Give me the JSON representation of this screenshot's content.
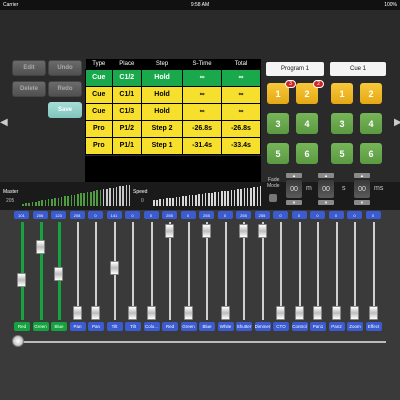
{
  "status": {
    "carrier": "Carrier",
    "time": "9:58 AM",
    "battery": "100%"
  },
  "editor": {
    "edit": "Edit",
    "undo": "Undo",
    "delete": "Delete",
    "redo": "Redo",
    "save": "Save"
  },
  "cues": {
    "headers": [
      "Type",
      "Place",
      "Step",
      "S-Time",
      "Total"
    ],
    "rows": [
      {
        "type": "Cue",
        "place": "C1/2",
        "step": "Hold",
        "stime": "∞",
        "total": "∞",
        "color": "green"
      },
      {
        "type": "Cue",
        "place": "C1/1",
        "step": "Hold",
        "stime": "∞",
        "total": "∞",
        "color": "yellow"
      },
      {
        "type": "Cue",
        "place": "C1/3",
        "step": "Hold",
        "stime": "∞",
        "total": "∞",
        "color": "yellow"
      },
      {
        "type": "Pro",
        "place": "P1/2",
        "step": "Step 2",
        "stime": "-26.8s",
        "total": "-26.8s",
        "color": "yellow"
      },
      {
        "type": "Pro",
        "place": "P1/1",
        "step": "Step 1",
        "stime": "-31.4s",
        "total": "-33.4s",
        "color": "yellow"
      }
    ]
  },
  "tabs": {
    "program": "Program 1",
    "cue": "Cue 1"
  },
  "pads": {
    "left": [
      "1",
      "2",
      "3",
      "4",
      "5",
      "6"
    ],
    "right": [
      "1",
      "2",
      "3",
      "4",
      "5",
      "6"
    ],
    "badges": [
      "3",
      "2"
    ]
  },
  "fade": {
    "label1": "Fade",
    "label2": "Mode",
    "m_value": "00",
    "m_unit": "m",
    "s_value": "00",
    "s_unit": "s",
    "ms_value": "00",
    "ms_unit": "ms"
  },
  "master": {
    "label": "Master",
    "value": "205"
  },
  "speed": {
    "label": "Speed",
    "value": "0"
  },
  "channels": [
    {
      "name": "Red",
      "value": "101",
      "level": 0.4,
      "color": "green"
    },
    {
      "name": "Green",
      "value": "206",
      "level": 0.81,
      "color": "green"
    },
    {
      "name": "Blue",
      "value": "123",
      "level": 0.48,
      "color": "green"
    },
    {
      "name": "Pan",
      "value": "208",
      "level": 0.0,
      "color": "blue"
    },
    {
      "name": "Pan",
      "value": "0",
      "level": 0.0,
      "color": "blue"
    },
    {
      "name": "Tilt",
      "value": "141",
      "level": 0.55,
      "color": "blue"
    },
    {
      "name": "Tilt",
      "value": "0",
      "level": 0.0,
      "color": "blue"
    },
    {
      "name": "Colo...",
      "value": "0",
      "level": 0.0,
      "color": "blue"
    },
    {
      "name": "Red",
      "value": "255",
      "level": 1.0,
      "color": "blue"
    },
    {
      "name": "Green",
      "value": "0",
      "level": 0.0,
      "color": "blue"
    },
    {
      "name": "Blue",
      "value": "255",
      "level": 1.0,
      "color": "blue"
    },
    {
      "name": "White",
      "value": "0",
      "level": 0.0,
      "color": "blue"
    },
    {
      "name": "Shutter",
      "value": "255",
      "level": 1.0,
      "color": "blue"
    },
    {
      "name": "Dimmer",
      "value": "255",
      "level": 1.0,
      "color": "blue"
    },
    {
      "name": "CTO",
      "value": "0",
      "level": 0.0,
      "color": "blue"
    },
    {
      "name": "Control",
      "value": "0",
      "level": 0.0,
      "color": "blue"
    },
    {
      "name": "Pan1",
      "value": "0",
      "level": 0.0,
      "color": "blue"
    },
    {
      "name": "Pan2",
      "value": "0",
      "level": 0.0,
      "color": "blue"
    },
    {
      "name": "Zoom",
      "value": "0",
      "level": 0.0,
      "color": "blue"
    },
    {
      "name": "Effect",
      "value": "0",
      "level": 0.0,
      "color": "blue"
    }
  ]
}
